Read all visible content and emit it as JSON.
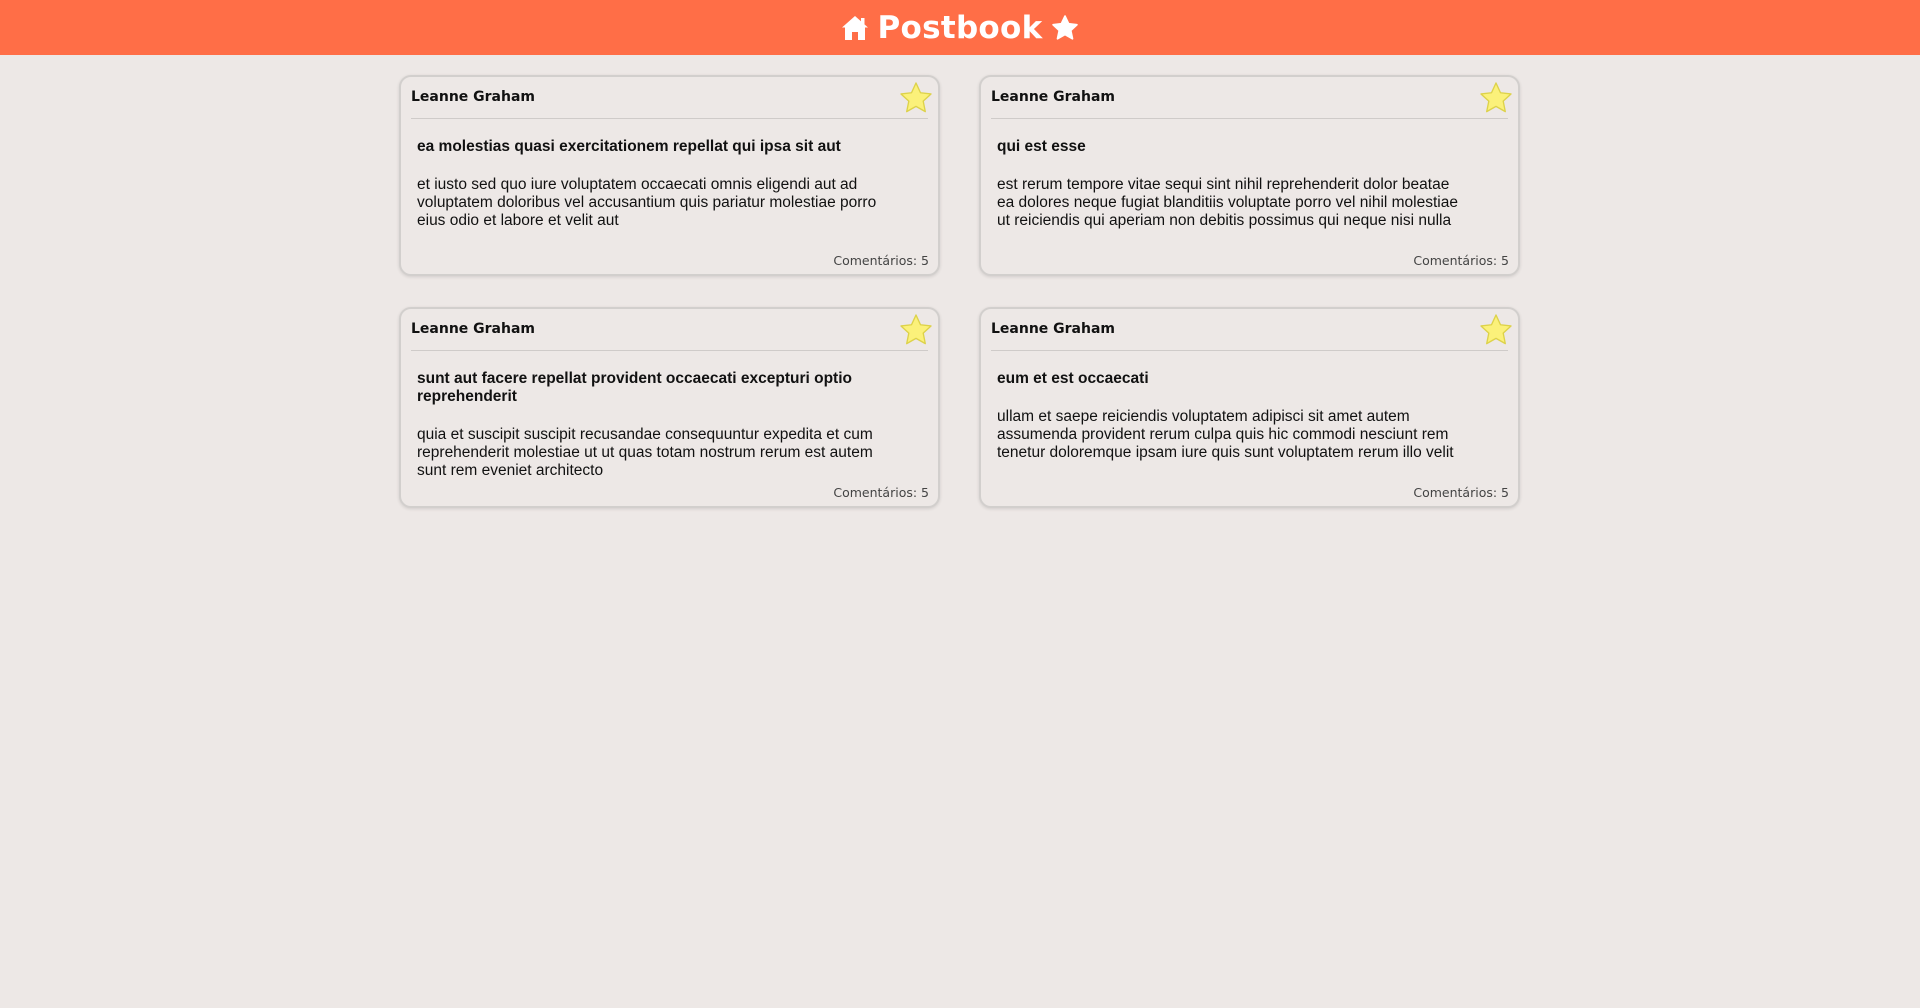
{
  "header": {
    "title": "Postbook",
    "home_icon": "home-icon",
    "star_icon": "star-icon",
    "background_color": "#ff6e47"
  },
  "posts": [
    {
      "author": "Leanne Graham",
      "title": "ea molestias quasi exercitationem repellat qui ipsa sit aut",
      "body": "et iusto sed quo iure voluptatem occaecati omnis eligendi aut ad voluptatem doloribus vel accusantium quis pariatur molestiae porro eius odio et labore et velit aut",
      "comments": "Comentários: 5"
    },
    {
      "author": "Leanne Graham",
      "title": "qui est esse",
      "body": "est rerum tempore vitae sequi sint nihil reprehenderit dolor beatae ea dolores neque fugiat blanditiis voluptate porro vel nihil molestiae ut reiciendis qui aperiam non debitis possimus qui neque nisi nulla",
      "comments": "Comentários: 5"
    },
    {
      "author": "Leanne Graham",
      "title": "sunt aut facere repellat provident occaecati excepturi optio reprehenderit",
      "body": "quia et suscipit suscipit recusandae consequuntur expedita et cum reprehenderit molestiae ut ut quas totam nostrum rerum est autem sunt rem eveniet architecto",
      "comments": "Comentários: 5"
    },
    {
      "author": "Leanne Graham",
      "title": "eum et est occaecati",
      "body": "ullam et saepe reiciendis voluptatem adipisci sit amet autem assumenda provident rerum culpa quis hic commodi nesciunt rem tenetur doloremque ipsam iure quis sunt voluptatem rerum illo velit",
      "comments": "Comentários: 5"
    }
  ],
  "favorite_icon": "star-outline-icon",
  "favorite_color": "#fbf17a"
}
